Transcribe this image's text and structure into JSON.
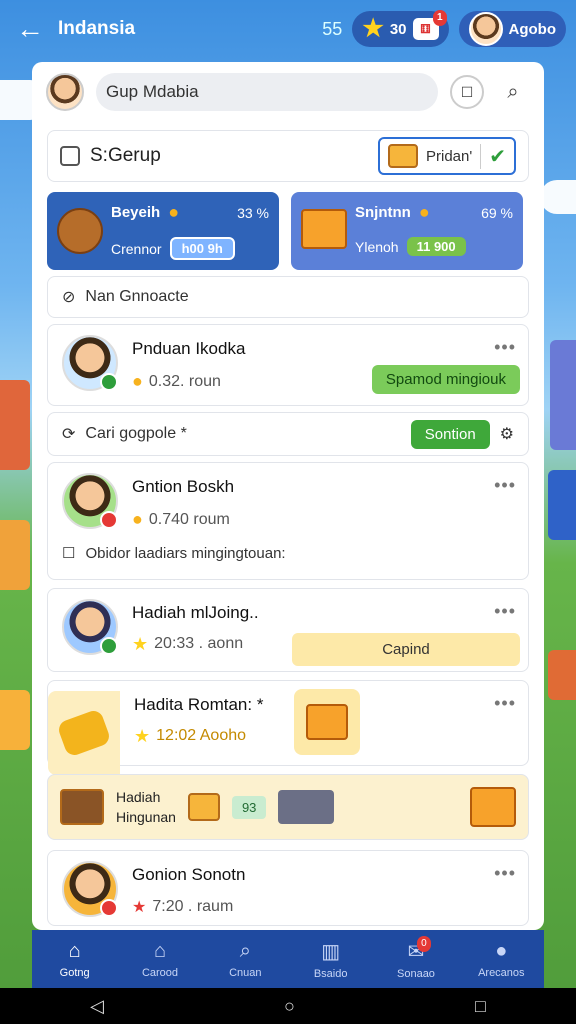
{
  "topbar": {
    "title": "Indansia",
    "level": "55",
    "stars": "30",
    "dice_badge": "1",
    "username": "Agobo"
  },
  "search": {
    "value": "Gup  Mdabia"
  },
  "group": {
    "label": "S:Gerup",
    "tag": "Pridan'"
  },
  "stats": [
    {
      "name": "Beyeih",
      "pct": "33 %",
      "sub": "Crennor",
      "chip": "h00   9h"
    },
    {
      "name": "Snjntnn",
      "pct": "69 %",
      "sub": "Ylenoh",
      "chip": "11   900"
    }
  ],
  "row_nan": {
    "label": "Nan Gnnoacte"
  },
  "players": [
    {
      "name": "Pnduan Ikodka",
      "meta": "0.32. roun",
      "action": "Spamod mingiouk"
    },
    {
      "name": "Gntion Boskh",
      "meta": "0.740  roum",
      "note": "Obidor laadiars mingingtouan:"
    },
    {
      "name": "Hadiah mlJoing..",
      "meta": "20:33 . aonn",
      "action": "Capind"
    },
    {
      "name": "Hadita Romtan: *",
      "meta": "12:02 Aooho"
    },
    {
      "name": "Gonion Sonotn",
      "meta": "7:20 . raum"
    }
  ],
  "row_cari": {
    "label": "Cari gogpole *",
    "button": "Sontion"
  },
  "reward": {
    "line1": "Hadiah",
    "line2": "Hingunan",
    "chip": "93"
  },
  "nav": [
    {
      "label": "Gotng",
      "icon": "home-icon"
    },
    {
      "label": "Carood",
      "icon": "house-icon"
    },
    {
      "label": "Cnuan",
      "icon": "search-icon"
    },
    {
      "label": "Bsaido",
      "icon": "building-icon"
    },
    {
      "label": "Sonaao",
      "icon": "mail-icon",
      "badge": "0"
    },
    {
      "label": "Arecanos",
      "icon": "person-icon"
    }
  ]
}
